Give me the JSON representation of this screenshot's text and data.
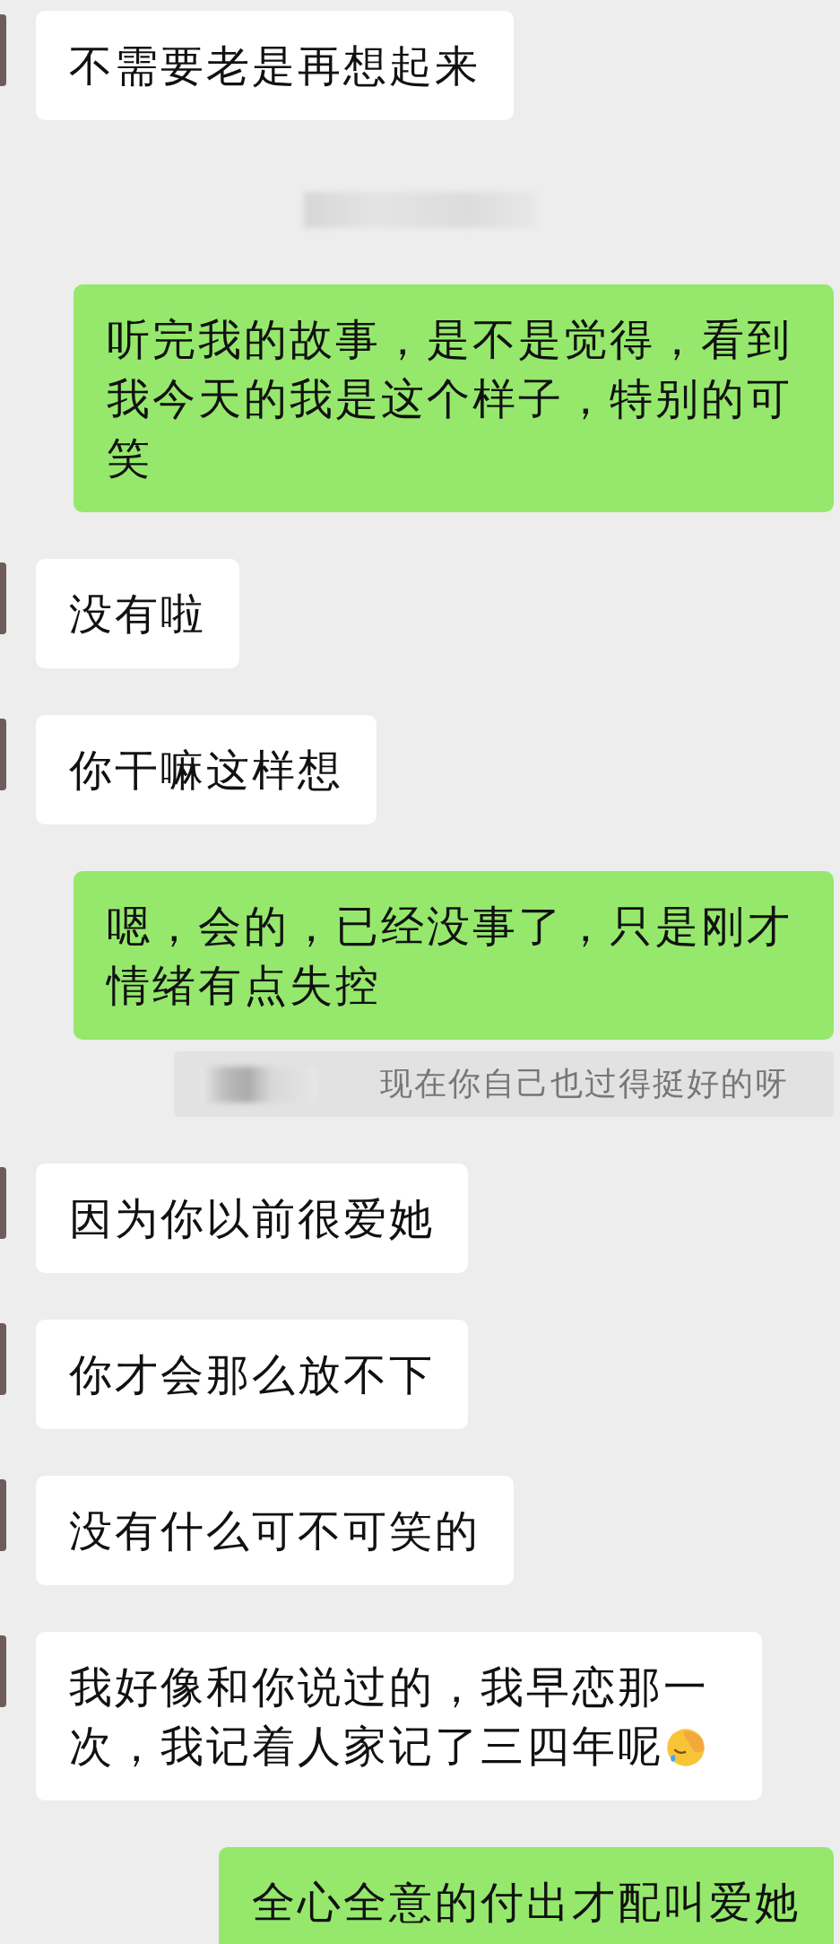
{
  "messages": [
    {
      "kind": "received",
      "text": "不需要老是再想起来"
    },
    {
      "kind": "redacted_time"
    },
    {
      "kind": "sent",
      "text": "听完我的故事，是不是觉得，看到我今天的我是这个样子，特别的可笑"
    },
    {
      "kind": "received",
      "text": "没有啦"
    },
    {
      "kind": "received",
      "text": "你干嘛这样想"
    },
    {
      "kind": "sent",
      "text": "嗯，会的，已经没事了，只是刚才情绪有点失控"
    },
    {
      "kind": "quote",
      "text": "现在你自己也过得挺好的呀"
    },
    {
      "kind": "received",
      "text": "因为你以前很爱她"
    },
    {
      "kind": "received",
      "text": "你才会那么放不下"
    },
    {
      "kind": "received",
      "text": "没有什么可不可笑的"
    },
    {
      "kind": "received",
      "text": "我好像和你说过的，我早恋那一次，我记着人家记了三四年呢",
      "emoji": true
    },
    {
      "kind": "sent",
      "text": "全心全意的付出才配叫爱她"
    }
  ]
}
